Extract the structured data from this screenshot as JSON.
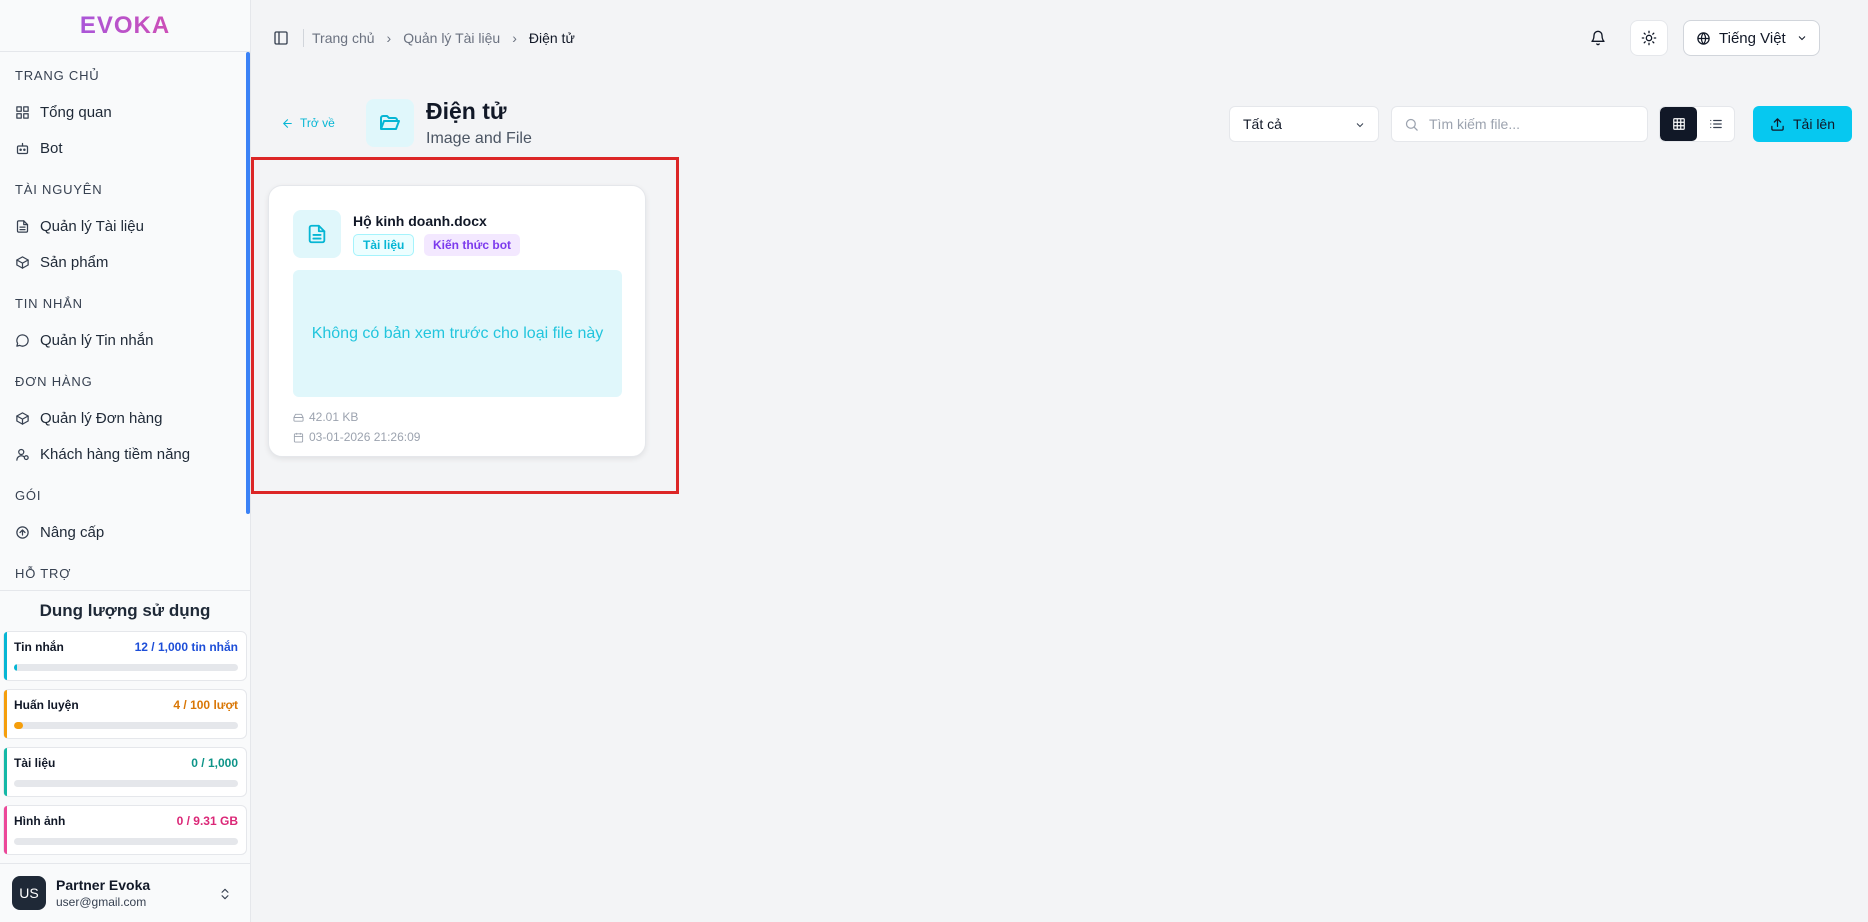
{
  "sidebar": {
    "logo": "EVOKA",
    "groups": [
      {
        "title": "TRANG CHỦ",
        "items": [
          {
            "label": "Tổng quan",
            "icon": "grid-icon"
          },
          {
            "label": "Bot",
            "icon": "bot-icon"
          }
        ]
      },
      {
        "title": "TÀI NGUYÊN",
        "items": [
          {
            "label": "Quản lý Tài liệu",
            "icon": "document-icon"
          },
          {
            "label": "Sản phẩm",
            "icon": "box-icon"
          }
        ]
      },
      {
        "title": "TIN NHẮN",
        "items": [
          {
            "label": "Quản lý Tin nhắn",
            "icon": "message-icon"
          }
        ]
      },
      {
        "title": "ĐƠN HÀNG",
        "items": [
          {
            "label": "Quản lý Đơn hàng",
            "icon": "box-icon"
          },
          {
            "label": "Khách hàng tiềm năng",
            "icon": "user-icon"
          }
        ]
      },
      {
        "title": "GÓI",
        "items": [
          {
            "label": "Nâng cấp",
            "icon": "arrow-up-circle-icon"
          }
        ]
      },
      {
        "title": "HỖ TRỢ",
        "items": []
      }
    ],
    "usage": {
      "title": "Dung lượng sử dụng",
      "items": [
        {
          "label": "Tin nhắn",
          "value": "12 / 1,000 tin nhắn",
          "percent": 1.2,
          "color": "#06b6d4",
          "value_color": "#1d4ed8"
        },
        {
          "label": "Huấn luyện",
          "value": "4 / 100 lượt",
          "percent": 4,
          "color": "#f59e0b",
          "value_color": "#d97706"
        },
        {
          "label": "Tài liệu",
          "value": "0 / 1,000",
          "percent": 0,
          "color": "#14b8a6",
          "value_color": "#0d9488"
        },
        {
          "label": "Hình ảnh",
          "value": "0 / 9.31 GB",
          "percent": 0,
          "color": "#ec4899",
          "value_color": "#db2777"
        }
      ]
    },
    "profile": {
      "initials": "US",
      "name": "Partner Evoka",
      "email": "user@gmail.com"
    }
  },
  "header": {
    "breadcrumbs": [
      "Trang chủ",
      "Quản lý Tài liệu",
      "Điện tử"
    ],
    "language": "Tiếng Việt"
  },
  "page": {
    "back_label": "Trở về",
    "title": "Điện tử",
    "subtitle": "Image and File",
    "filter_value": "Tất cả",
    "search_placeholder": "Tìm kiếm file...",
    "upload_label": "Tải lên"
  },
  "files": [
    {
      "name": "Hộ kinh doanh.docx",
      "tags": [
        "Tài liệu",
        "Kiến thức bot"
      ],
      "preview_text": "Không có bản xem trước cho loại file này",
      "size": "42.01 KB",
      "date": "03-01-2026 21:26:09"
    }
  ],
  "colors": {
    "accent": "#06c8f0",
    "highlight": "#dc2626"
  }
}
